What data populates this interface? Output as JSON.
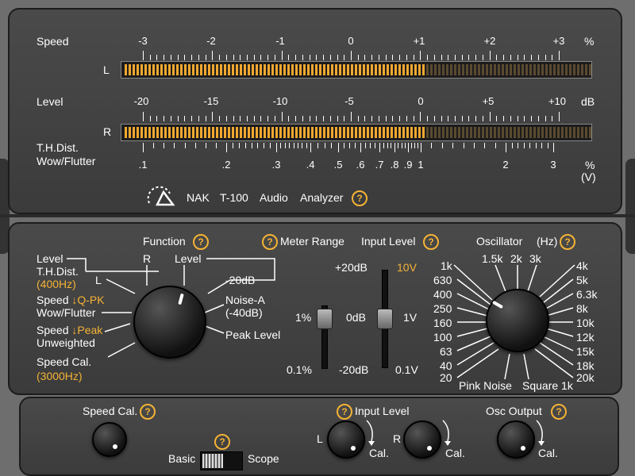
{
  "top": {
    "speed_label": "Speed",
    "level_label": "Level",
    "thd_label": "T.H.Dist.",
    "wow_label": "Wow/Flutter",
    "ch_L": "L",
    "ch_R": "R",
    "speed_ticks": [
      "-3",
      "-2",
      "-1",
      "0",
      "+1",
      "+2",
      "+3"
    ],
    "speed_unit": "%",
    "level_ticks": [
      "-20",
      "-15",
      "-10",
      "-5",
      "0",
      "+5",
      "+10"
    ],
    "level_unit": "dB",
    "thd_ticks": [
      ".1",
      ".2",
      ".3",
      ".4",
      ".5",
      ".6",
      ".7",
      ".8",
      ".9",
      "1",
      "2",
      "3"
    ],
    "thd_unit": "%",
    "thd_unit2": "(V)",
    "meter_L_level": 0.64,
    "meter_R_level": 0.64,
    "brand": "NAK",
    "model": "T-100",
    "word1": "Audio",
    "word2": "Analyzer",
    "help": "?"
  },
  "function": {
    "title": "Function",
    "help": "?",
    "level": "Level",
    "thd": "T.H.Dist.",
    "thd_freq": "(400Hz)",
    "L": "L",
    "R": "R",
    "level2": "Level",
    "m20db": "-20dB",
    "speed_qpk_a": "Speed ",
    "speed_qpk_b": "↓Q-PK",
    "wow": "Wow/Flutter",
    "noise_a": "Noise-A",
    "noise_a2": "(-40dB)",
    "speed_peak_a": "Speed ",
    "speed_peak_b": "↓Peak",
    "unweighted": "Unweighted",
    "peak_level": "Peak Level",
    "speed_cal": "Speed Cal.",
    "speed_cal_freq": "(3000Hz)"
  },
  "meter_range": {
    "title": "Meter Range",
    "help": "?",
    "p20": "+20dB",
    "pct1": "1%",
    "zero": "0dB",
    "pct01": "0.1%",
    "m20": "-20dB"
  },
  "input_level": {
    "title": "Input Level",
    "help": "?",
    "v10": "10V",
    "v1": "1V",
    "v01": "0.1V"
  },
  "oscillator": {
    "title": "Oscillator",
    "unit": "(Hz)",
    "help": "?",
    "left": [
      "1k",
      "630",
      "400",
      "250",
      "160",
      "100",
      "63",
      "40",
      "20"
    ],
    "top": [
      "1.5k",
      "2k",
      "3k"
    ],
    "right": [
      "4k",
      "5k",
      "6.3k",
      "8k",
      "10k",
      "12k",
      "15k",
      "18k",
      "20k"
    ],
    "pink": "Pink Noise",
    "square": "Square 1k"
  },
  "bottom": {
    "speed_cal": "Speed Cal.",
    "help": "?",
    "basic": "Basic",
    "scope": "Scope",
    "input_level": "Input Level",
    "L": "L",
    "R": "R",
    "cal": "Cal.",
    "osc_output": "Osc Output"
  },
  "colors": {
    "accent": "#f5b335",
    "meter_on": "#f0a830",
    "meter_off": "#5a4a30"
  }
}
